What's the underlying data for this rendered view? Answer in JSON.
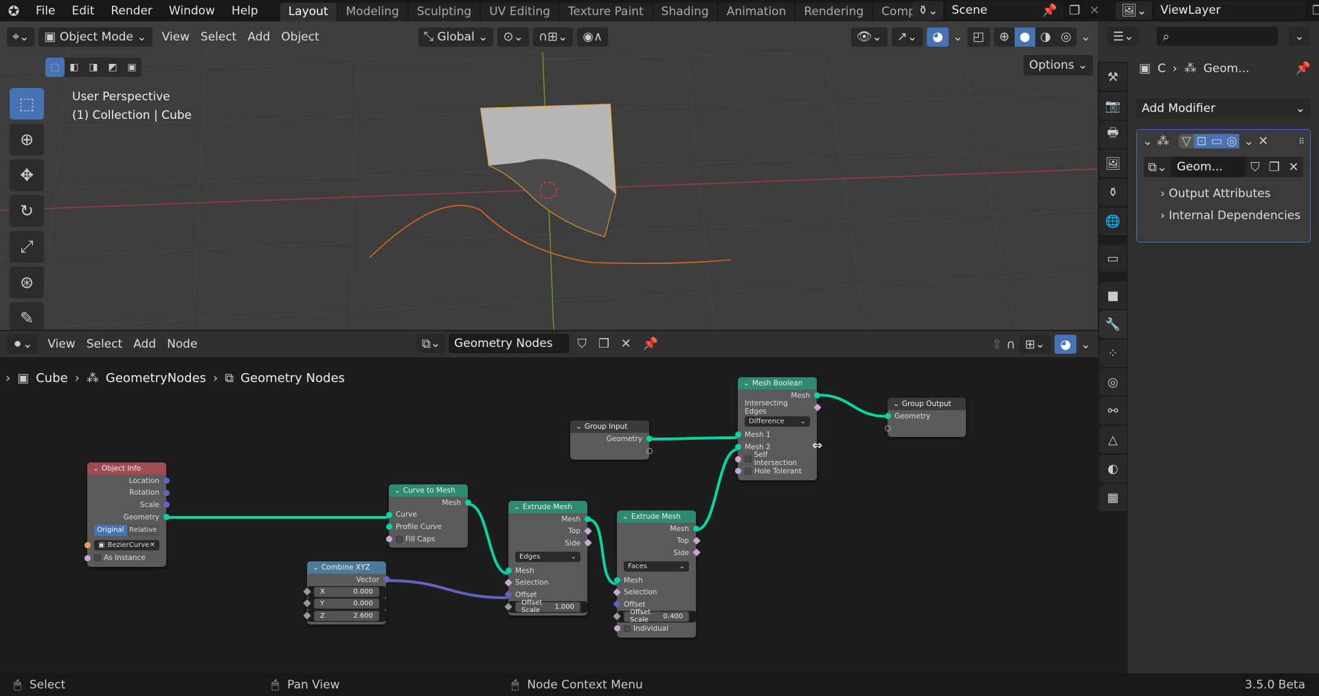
{
  "app": {
    "menus": [
      "File",
      "Edit",
      "Render",
      "Window",
      "Help"
    ],
    "workspaces": [
      "Layout",
      "Modeling",
      "Sculpting",
      "UV Editing",
      "Texture Paint",
      "Shading",
      "Animation",
      "Rendering",
      "Compo"
    ],
    "active_workspace": "Layout",
    "scene": "Scene",
    "view_layer": "ViewLayer"
  },
  "viewport": {
    "mode": "Object Mode",
    "menus": [
      "View",
      "Select",
      "Add",
      "Object"
    ],
    "orientation": "Global",
    "options_label": "Options",
    "overlay_title": "User Perspective",
    "overlay_subtitle": "(1) Collection | Cube",
    "tools": [
      "select-box",
      "cursor",
      "move",
      "rotate",
      "scale",
      "transform",
      "annotate"
    ],
    "accent": "#4772b3",
    "selection_color": "#f5a623"
  },
  "node_editor": {
    "menus": [
      "View",
      "Select",
      "Add",
      "Node"
    ],
    "node_group": "Geometry Nodes",
    "breadcrumb": [
      "Cube",
      "GeometryNodes",
      "Geometry Nodes"
    ],
    "nodes": [
      {
        "id": "objinfo",
        "title": "Object Info",
        "color": "#a04a52",
        "rows": [
          {
            "t": "out",
            "label": "Location",
            "s": "#6363c7"
          },
          {
            "t": "out",
            "label": "Rotation",
            "s": "#6363c7"
          },
          {
            "t": "out",
            "label": "Scale",
            "s": "#6363c7"
          },
          {
            "t": "out",
            "label": "Geometry",
            "s": "#00d6a3"
          },
          {
            "t": "toggle",
            "options": [
              "Original",
              "Relative"
            ],
            "active": "Original"
          },
          {
            "t": "objfield",
            "label": "BezierCurve",
            "s": "#ed9e5c"
          },
          {
            "t": "check",
            "label": "As Instance",
            "s": "#cca6d6"
          }
        ]
      },
      {
        "id": "c2m",
        "title": "Curve to Mesh",
        "color": "#2f8a72",
        "rows": [
          {
            "t": "out",
            "label": "Mesh",
            "s": "#00d6a3"
          },
          {
            "t": "in",
            "label": "Curve",
            "s": "#00d6a3"
          },
          {
            "t": "in",
            "label": "Profile Curve",
            "s": "#00d6a3"
          },
          {
            "t": "check",
            "label": "Fill Caps",
            "s": "#cca6d6"
          }
        ]
      },
      {
        "id": "cxyz",
        "title": "Combine XYZ",
        "color": "#4b7a9b",
        "rows": [
          {
            "t": "out",
            "label": "Vector",
            "s": "#6363c7",
            "dia": true
          },
          {
            "t": "field",
            "label": "X",
            "value": "0.000",
            "s": "#999",
            "dia": true
          },
          {
            "t": "field",
            "label": "Y",
            "value": "0.000",
            "s": "#999",
            "dia": true
          },
          {
            "t": "field",
            "label": "Z",
            "value": "2.600",
            "s": "#999",
            "dia": true
          }
        ]
      },
      {
        "id": "ext1",
        "title": "Extrude Mesh",
        "color": "#2f8a72",
        "rows": [
          {
            "t": "out",
            "label": "Mesh",
            "s": "#00d6a3"
          },
          {
            "t": "out",
            "label": "Top",
            "s": "#cca6d6",
            "dia": true
          },
          {
            "t": "out",
            "label": "Side",
            "s": "#cca6d6",
            "dia": true
          },
          {
            "t": "drop",
            "label": "Edges"
          },
          {
            "t": "in",
            "label": "Mesh",
            "s": "#00d6a3"
          },
          {
            "t": "in",
            "label": "Selection",
            "s": "#cca6d6",
            "dia": true
          },
          {
            "t": "in",
            "label": "Offset",
            "s": "#6363c7",
            "dia": true
          },
          {
            "t": "field",
            "label": "Offset Scale",
            "value": "1.000",
            "s": "#999",
            "dia": true
          }
        ]
      },
      {
        "id": "ext2",
        "title": "Extrude Mesh",
        "color": "#2f8a72",
        "rows": [
          {
            "t": "out",
            "label": "Mesh",
            "s": "#00d6a3"
          },
          {
            "t": "out",
            "label": "Top",
            "s": "#cca6d6",
            "dia": true
          },
          {
            "t": "out",
            "label": "Side",
            "s": "#cca6d6",
            "dia": true
          },
          {
            "t": "drop",
            "label": "Faces"
          },
          {
            "t": "in",
            "label": "Mesh",
            "s": "#00d6a3"
          },
          {
            "t": "in",
            "label": "Selection",
            "s": "#cca6d6",
            "dia": true
          },
          {
            "t": "in",
            "label": "Offset",
            "s": "#6363c7",
            "dia": true
          },
          {
            "t": "field",
            "label": "Offset Scale",
            "value": "0.400",
            "s": "#999",
            "dia": true
          },
          {
            "t": "check",
            "label": "Individual",
            "s": "#cca6d6"
          }
        ]
      },
      {
        "id": "gin",
        "title": "Group Input",
        "color": "#3b3b3b",
        "rows": [
          {
            "t": "out",
            "label": "Geometry",
            "s": "#00d6a3"
          },
          {
            "t": "out",
            "label": "",
            "s": "empty"
          }
        ]
      },
      {
        "id": "bool",
        "title": "Mesh Boolean",
        "color": "#2f8a72",
        "rows": [
          {
            "t": "out",
            "label": "Mesh",
            "s": "#00d6a3"
          },
          {
            "t": "out",
            "label": "Intersecting Edges",
            "s": "#cca6d6",
            "dia": true
          },
          {
            "t": "drop",
            "label": "Difference"
          },
          {
            "t": "in",
            "label": "Mesh 1",
            "s": "#00d6a3"
          },
          {
            "t": "in",
            "label": "Mesh 2",
            "s": "#00d6a3"
          },
          {
            "t": "check",
            "label": "Self Intersection",
            "s": "#cca6d6"
          },
          {
            "t": "check",
            "label": "Hole Tolerant",
            "s": "#cca6d6"
          }
        ]
      },
      {
        "id": "gout",
        "title": "Group Output",
        "color": "#3b3b3b",
        "rows": [
          {
            "t": "in",
            "label": "Geometry",
            "s": "#00d6a3"
          },
          {
            "t": "in",
            "label": "",
            "s": "empty"
          }
        ]
      }
    ],
    "link_colors": {
      "geometry": "#00d6a3",
      "vector": "#6363c7"
    }
  },
  "properties": {
    "breadcrumb": [
      "C",
      "Geom..."
    ],
    "add_modifier": "Add Modifier",
    "modifier_group": "Geom...",
    "panels": [
      "Output Attributes",
      "Internal Dependencies"
    ]
  },
  "status": {
    "items": [
      "Select",
      "Pan View",
      "Node Context Menu"
    ],
    "version": "3.5.0 Beta"
  }
}
